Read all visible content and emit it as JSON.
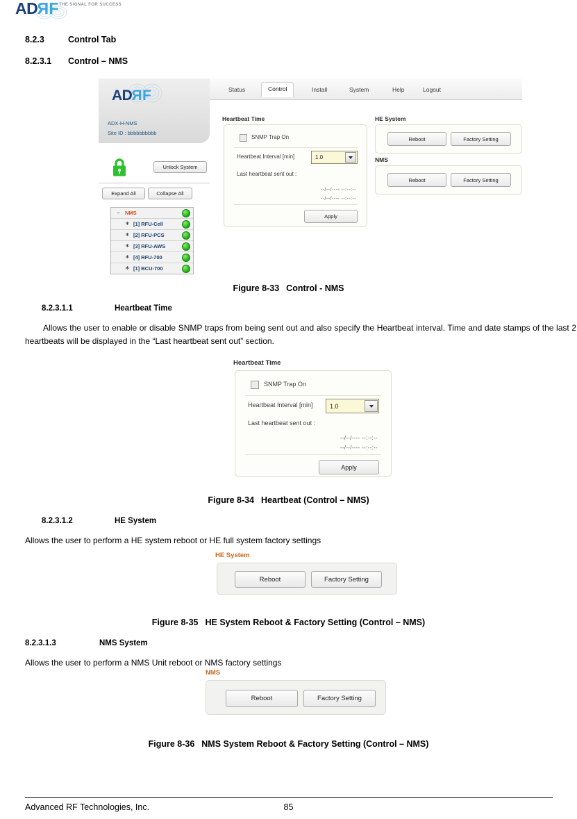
{
  "brand": {
    "logo_ad": "AD",
    "logo_r": "R",
    "logo_f": "F",
    "tagline": "THE SIGNAL FOR SUCCESS",
    "accent_blue": "#1b3f7a",
    "accent_cyan": "#3aa6dd"
  },
  "sections": {
    "s823_num": "8.2.3",
    "s823_title": "Control Tab",
    "s8231_num": "8.2.3.1",
    "s8231_title": "Control – NMS",
    "s82311_num": "8.2.3.1.1",
    "s82311_title": "Heartbeat Time",
    "s82311_body": "Allows the user to enable or disable SNMP traps from being sent out and also specify the Heartbeat interval. Time and date stamps of the last 2 heartbeats will be displayed in the “Last heartbeat sent out” section.",
    "s82312_num": "8.2.3.1.2",
    "s82312_title": "HE System",
    "s82312_body": "Allows the user to perform a HE system reboot or HE full system factory settings",
    "s82313_num": "8.2.3.1.3",
    "s82313_title": "NMS System",
    "s82313_body": "Allows the user to perform a NMS Unit reboot or NMS factory settings"
  },
  "figures": {
    "f833_num": "Figure 8-33",
    "f833_title": "Control - NMS",
    "f834_num": "Figure 8-34",
    "f834_title": "Heartbeat (Control – NMS)",
    "f835_num": "Figure 8-35",
    "f835_title": "HE System Reboot & Factory Setting (Control – NMS)",
    "f836_num": "Figure 8-36",
    "f836_title": "NMS System Reboot & Factory Setting (Control – NMS)"
  },
  "screenshot": {
    "nav_tabs": [
      {
        "label": "Status",
        "active": false
      },
      {
        "label": "Control",
        "active": true
      },
      {
        "label": "Install",
        "active": false
      },
      {
        "label": "System",
        "active": false
      },
      {
        "label": "Help",
        "active": false
      },
      {
        "label": "Logout",
        "active": false
      }
    ],
    "device": {
      "model": "ADX-H-NMS",
      "site_id": "Site ID : bbbbbbbbbb"
    },
    "buttons": {
      "unlock_system": "Unlock System",
      "expand_all": "Expand All",
      "collapse_all": "Collapse All"
    },
    "tree": [
      {
        "label": "NMS",
        "marker": "−",
        "root": true
      },
      {
        "label": "[1] RFU-Cell",
        "marker": "∗",
        "root": false
      },
      {
        "label": "[2] RFU-PCS",
        "marker": "∗",
        "root": false
      },
      {
        "label": "[3] RFU-AWS",
        "marker": "∗",
        "root": false
      },
      {
        "label": "[4] RFU-700",
        "marker": "∗",
        "root": false
      },
      {
        "label": "[1] BCU-700",
        "marker": "∗",
        "root": false
      }
    ],
    "heartbeat": {
      "group_title": "Heartbeat Time",
      "snmp_trap_label": "SNMP Trap On",
      "interval_label": "Heartbeat Interval [min]",
      "interval_value": "1.0",
      "last_sent_label": "Last heartbeat sent out :",
      "stamp_1": "--/--/---- --:--:--",
      "stamp_2": "--/--/---- --:--:--",
      "apply_label": "Apply"
    },
    "he_system": {
      "group_title": "HE System",
      "reboot_label": "Reboot",
      "factory_label": "Factory Setting"
    },
    "nms_system": {
      "group_title": "NMS",
      "reboot_label": "Reboot",
      "factory_label": "Factory Setting"
    }
  },
  "footer": {
    "company": "Advanced RF Technologies, Inc.",
    "page_number": "85"
  }
}
